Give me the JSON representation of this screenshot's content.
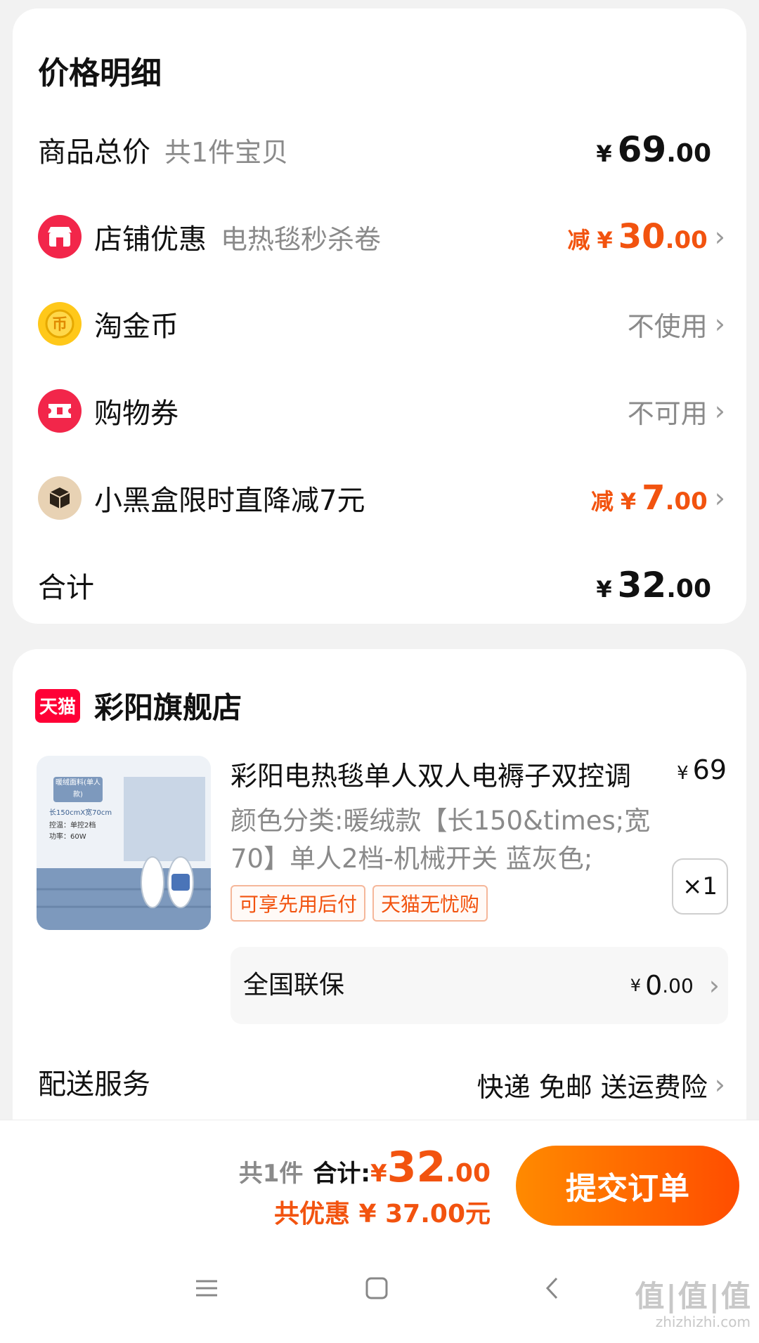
{
  "price_detail": {
    "title": "价格明细",
    "goods_total": {
      "label": "商品总价",
      "sub": "共1件宝贝",
      "yen": "¥",
      "int": "69",
      "dec": ".00"
    },
    "store_discount": {
      "label": "店铺优惠",
      "sub": "电热毯秒杀卷",
      "prefix": "减",
      "yen": "¥",
      "int": "30",
      "dec": ".00"
    },
    "taojinbi": {
      "label": "淘金币",
      "status": "不使用"
    },
    "coupon": {
      "label": "购物券",
      "status": "不可用"
    },
    "black_box": {
      "label": "小黑盒限时直降减7元",
      "prefix": "减",
      "yen": "¥",
      "int": "7",
      "dec": ".00"
    },
    "subtotal": {
      "label": "合计",
      "yen": "¥",
      "int": "32",
      "dec": ".00"
    }
  },
  "store": {
    "badge": "天猫",
    "name": "彩阳旗舰店",
    "product": {
      "title": "彩阳电热毯单人双人电褥子双控调",
      "price_yen": "¥",
      "price": "69",
      "spec": "颜色分类:暖绒款【长150&times;宽70】单人2档-机械开关 蓝灰色;",
      "tags": [
        "可享先用后付",
        "天猫无忧购"
      ],
      "qty": "×1",
      "image_labels": {
        "badge": "暖绒面料(单人款)",
        "size": "长150cmX宽70cm",
        "ctrl": "控温：单控2档",
        "power": "功率：60W"
      }
    },
    "warranty": {
      "label": "全国联保",
      "yen": "¥",
      "int": "0",
      "dec": ".00"
    },
    "delivery": {
      "label": "配送服务",
      "value": "快递 免邮 送运费险"
    }
  },
  "bottom_bar": {
    "count": "共1件",
    "total_label": "合计:",
    "yen": "¥",
    "int": "32",
    "dec": ".00",
    "saved": "共优惠 ¥ 37.00元",
    "submit": "提交订单"
  },
  "watermark": {
    "main": "值|值|值",
    "sub": "zhizhizhi.com"
  },
  "colors": {
    "accent": "#f2530f",
    "tmall_red": "#ff0036",
    "button_start": "#ff8a00",
    "button_end": "#ff4d00"
  },
  "icons": [
    "store-icon",
    "coin-icon",
    "ticket-icon",
    "box-icon",
    "chevron-right-icon",
    "menu-icon",
    "home-icon",
    "back-icon"
  ]
}
